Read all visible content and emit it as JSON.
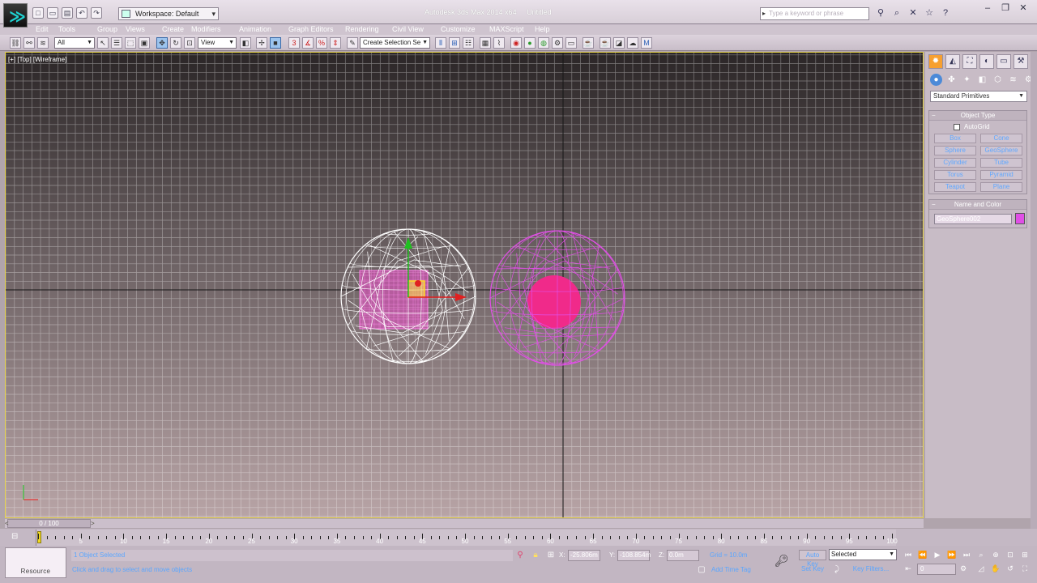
{
  "title_bar": {
    "title": "Autodesk 3ds Max 2014 x64",
    "document": "Untitled",
    "workspace": "Workspace: Default",
    "search_placeholder": "Type a keyword or phrase"
  },
  "menu": [
    "Edit",
    "Tools",
    "Group",
    "Views",
    "Create",
    "Modifiers",
    "Animation",
    "Graph Editors",
    "Rendering",
    "Civil View",
    "Customize",
    "MAXScript",
    "Help"
  ],
  "menu_extra": "Help",
  "toolbar": {
    "selection_filter": "All",
    "ref_coord": "View",
    "named_selection": "Create Selection Se"
  },
  "viewport": {
    "label": "[+] [Top] [Wireframe]"
  },
  "command_panel": {
    "category": "Standard Primitives",
    "object_type_title": "Object Type",
    "autogrid_label": "AutoGrid",
    "primitives": [
      "Box",
      "Cone",
      "Sphere",
      "GeoSphere",
      "Cylinder",
      "Tube",
      "Torus",
      "Pyramid",
      "Teapot",
      "Plane"
    ],
    "name_color_title": "Name and Color",
    "object_name": "GeoSphere002",
    "object_color": "#e04fe6"
  },
  "time_slider": {
    "position": "0 / 100",
    "current_frame": 0,
    "total_frames": 100
  },
  "timeline": {
    "labels": [
      0,
      5,
      10,
      15,
      20,
      25,
      30,
      35,
      40,
      45,
      50,
      55,
      60,
      65,
      70,
      75,
      80,
      85,
      90,
      95,
      100
    ]
  },
  "status": {
    "resource_label": "Resource",
    "selection": "1 Object Selected",
    "prompt": "Click and drag to select and move objects",
    "x_label": "X:",
    "y_label": "Y:",
    "z_label": "Z:",
    "x": "-25.806m",
    "y": "-108.854m",
    "z": "0.0m",
    "grid": "Grid = 10.0m",
    "add_time_tag": "Add Time Tag",
    "auto_key": "Auto Key",
    "set_key": "Set Key",
    "key_mode": "Selected",
    "key_filters": "Key Filters...",
    "frame": "0"
  },
  "colors": {
    "accent_active_tab": "#f7a030",
    "wire_white": "#ffffff",
    "wire_magenta": "#e04fe6",
    "viewport_border": "#e6d34a"
  }
}
